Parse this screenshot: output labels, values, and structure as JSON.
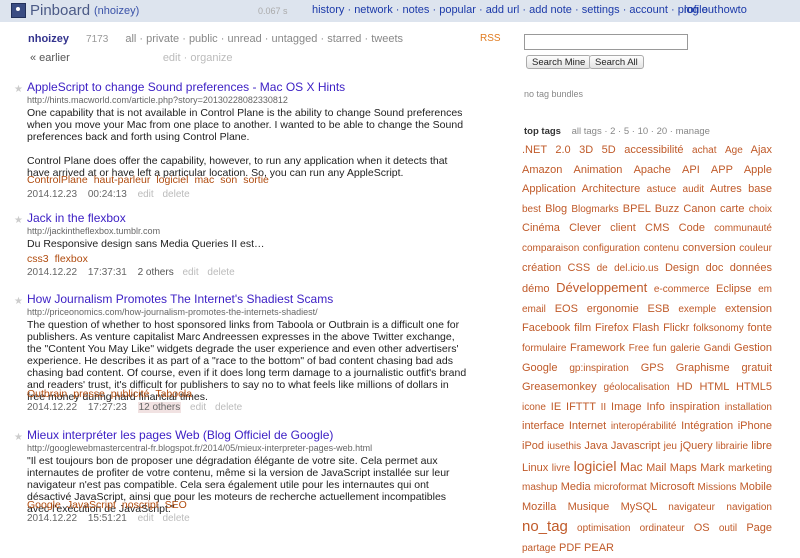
{
  "header": {
    "brand": "Pinboard",
    "user": "(nhoizey)",
    "timing": "0.067 s",
    "nav": [
      "history",
      "network",
      "notes",
      "popular",
      "add url",
      "add note",
      "settings",
      "account",
      "profile",
      "howto"
    ],
    "logout": "log out"
  },
  "filterbar": {
    "username": "nhoizey",
    "count": "7173",
    "filters": [
      "all",
      "private",
      "public",
      "unread",
      "untagged",
      "starred",
      "tweets"
    ],
    "rss": "RSS"
  },
  "pager": {
    "earlier": "« earlier",
    "edit": "edit",
    "organize": "organize"
  },
  "bookmarks": [
    {
      "title": "AppleScript to change Sound preferences - Mac OS X Hints",
      "url": "http://hints.macworld.com/article.php?story=20130228082330812",
      "desc1": "One capability that is not available in Control Plane is the ability to change Sound preferences when you move your Mac from one place to another. I wanted to be able to change the Sound preferences back and forth using Control Plane.",
      "desc2": "Control Plane does offer the capability, however, to run any application when it detects that have arrived at or have left a particular location. So, you can run any AppleScript.",
      "tags": [
        "ControlPlane",
        "haut-parleur",
        "logiciel",
        "mac",
        "son",
        "sortie"
      ],
      "date": "2014.12.23",
      "time": "00:24:13",
      "others": "",
      "edit": "edit",
      "delete": "delete"
    },
    {
      "title": "Jack in the flexbox",
      "url": "http://jackintheflexbox.tumblr.com",
      "desc1": "Du Responsive design sans Media Queries II est…",
      "desc2": "",
      "tags": [
        "css3",
        "flexbox"
      ],
      "date": "2014.12.22",
      "time": "17:37:31",
      "others": "2 others",
      "edit": "edit",
      "delete": "delete"
    },
    {
      "title": "How Journalism Promotes The Internet's Shadiest Scams",
      "url": "http://priceonomics.com/how-journalism-promotes-the-internets-shadiest/",
      "desc1": "The question of whether to host sponsored links from Taboola or Outbrain is a difficult one for publishers. As venture capitalist Marc Andreessen expresses in the above Twitter exchange, the \"Content You May Like\" widgets degrade the user experience and even other advertisers' experience. He describes it as part of a \"race to the bottom\" of bad content chasing bad ads chasing bad content. Of course, even if it does long term damage to a journalistic outfit's brand and readers' trust, it's difficult for publishers to say no to what feels like millions of dollars in free money during hard financial times.",
      "desc2": "",
      "tags": [
        "Outbrain",
        "presse",
        "publicité",
        "Taboola"
      ],
      "date": "2014.12.22",
      "time": "17:27:23",
      "others": "12 others",
      "edit": "edit",
      "delete": "delete"
    },
    {
      "title": "Mieux interpréter les pages Web (Blog Officiel de Google)",
      "url": "http://googlewebmastercentral-fr.blogspot.fr/2014/05/mieux-interpreter-pages-web.html",
      "desc1": "\"Il est toujours bon de proposer une dégradation élégante de votre site. Cela permet aux internautes de profiter de votre contenu, même si la version de JavaScript installée sur leur navigateur n'est pas compatible. Cela sera également utile pour les internautes qui ont désactivé JavaScript, ainsi que pour les moteurs de recherche actuellement incompatibles avec l'exécution de JavaScript.\"",
      "desc2": "",
      "tags": [
        "Google",
        "JavaScript",
        "noscript",
        "SEO"
      ],
      "date": "2014.12.22",
      "time": "15:51:21",
      "others": "",
      "edit": "edit",
      "delete": "delete"
    }
  ],
  "sidebar": {
    "search_mine": "Search Mine",
    "search_all": "Search All",
    "no_bundles": "no tag bundles",
    "top_tags": "top tags",
    "tag_options": "all tags · 2 · 5 · 10 · 20 · manage",
    "tags": [
      {
        "t": ".NET",
        "s": 11
      },
      {
        "t": "2.0",
        "s": 11
      },
      {
        "t": "3D",
        "s": 11
      },
      {
        "t": "5D",
        "s": 11
      },
      {
        "t": "accessibilité",
        "s": 11
      },
      {
        "t": "achat",
        "s": 10
      },
      {
        "t": "Age",
        "s": 10
      },
      {
        "t": "Ajax",
        "s": 11
      },
      {
        "t": "Amazon",
        "s": 11
      },
      {
        "t": "Animation",
        "s": 11
      },
      {
        "t": "Apache",
        "s": 11
      },
      {
        "t": "API",
        "s": 11
      },
      {
        "t": "APP",
        "s": 11
      },
      {
        "t": "Apple",
        "s": 11
      },
      {
        "t": "Application",
        "s": 11
      },
      {
        "t": "Architecture",
        "s": 11
      },
      {
        "t": "astuce",
        "s": 10
      },
      {
        "t": "audit",
        "s": 10
      },
      {
        "t": "Autres",
        "s": 11
      },
      {
        "t": "base",
        "s": 11
      },
      {
        "t": "best",
        "s": 10
      },
      {
        "t": "Blog",
        "s": 11
      },
      {
        "t": "Blogmarks",
        "s": 10
      },
      {
        "t": "BPEL",
        "s": 11
      },
      {
        "t": "Buzz",
        "s": 11
      },
      {
        "t": "Canon",
        "s": 11
      },
      {
        "t": "carte",
        "s": 11
      },
      {
        "t": "choix",
        "s": 10
      },
      {
        "t": "Cinéma",
        "s": 11
      },
      {
        "t": "Clever",
        "s": 11
      },
      {
        "t": "client",
        "s": 11
      },
      {
        "t": "CMS",
        "s": 11
      },
      {
        "t": "Code",
        "s": 11
      },
      {
        "t": "communauté",
        "s": 10
      },
      {
        "t": "comparaison",
        "s": 10
      },
      {
        "t": "configuration",
        "s": 10
      },
      {
        "t": "contenu",
        "s": 10
      },
      {
        "t": "conversion",
        "s": 11
      },
      {
        "t": "couleur",
        "s": 10
      },
      {
        "t": "création",
        "s": 11
      },
      {
        "t": "CSS",
        "s": 11
      },
      {
        "t": "de",
        "s": 10
      },
      {
        "t": "del.icio.us",
        "s": 10
      },
      {
        "t": "Design",
        "s": 11
      },
      {
        "t": "doc",
        "s": 11
      },
      {
        "t": "données",
        "s": 11
      },
      {
        "t": "démo",
        "s": 11
      },
      {
        "t": "Développement",
        "s": 13
      },
      {
        "t": "e-commerce",
        "s": 10
      },
      {
        "t": "Eclipse",
        "s": 11
      },
      {
        "t": "em",
        "s": 10
      },
      {
        "t": "email",
        "s": 10
      },
      {
        "t": "EOS",
        "s": 11
      },
      {
        "t": "ergonomie",
        "s": 11
      },
      {
        "t": "ESB",
        "s": 11
      },
      {
        "t": "exemple",
        "s": 10
      },
      {
        "t": "extension",
        "s": 11
      },
      {
        "t": "Facebook",
        "s": 11
      },
      {
        "t": "film",
        "s": 11
      },
      {
        "t": "Firefox",
        "s": 11
      },
      {
        "t": "Flash",
        "s": 11
      },
      {
        "t": "Flickr",
        "s": 11
      },
      {
        "t": "folksonomy",
        "s": 10
      },
      {
        "t": "fonte",
        "s": 11
      },
      {
        "t": "formulaire",
        "s": 10
      },
      {
        "t": "Framework",
        "s": 11
      },
      {
        "t": "Free",
        "s": 10
      },
      {
        "t": "fun",
        "s": 10
      },
      {
        "t": "galerie",
        "s": 10
      },
      {
        "t": "Gandi",
        "s": 10
      },
      {
        "t": "Gestion",
        "s": 11
      },
      {
        "t": "Google",
        "s": 11
      },
      {
        "t": "gp:inspiration",
        "s": 10
      },
      {
        "t": "GPS",
        "s": 11
      },
      {
        "t": "Graphisme",
        "s": 11
      },
      {
        "t": "gratuit",
        "s": 11
      },
      {
        "t": "Greasemonkey",
        "s": 11
      },
      {
        "t": "géolocalisation",
        "s": 10
      },
      {
        "t": "HD",
        "s": 11
      },
      {
        "t": "HTML",
        "s": 11
      },
      {
        "t": "HTML5",
        "s": 11
      },
      {
        "t": "icone",
        "s": 10
      },
      {
        "t": "IE",
        "s": 11
      },
      {
        "t": "IFTTT",
        "s": 11
      },
      {
        "t": "II",
        "s": 10
      },
      {
        "t": "Image",
        "s": 11
      },
      {
        "t": "Info",
        "s": 11
      },
      {
        "t": "inspiration",
        "s": 11
      },
      {
        "t": "installation",
        "s": 10
      },
      {
        "t": "interface",
        "s": 11
      },
      {
        "t": "Internet",
        "s": 11
      },
      {
        "t": "interopérabilité",
        "s": 10
      },
      {
        "t": "Intégration",
        "s": 11
      },
      {
        "t": "iPhone",
        "s": 11
      },
      {
        "t": "iPod",
        "s": 11
      },
      {
        "t": "iusethis",
        "s": 10
      },
      {
        "t": "Java",
        "s": 11
      },
      {
        "t": "Javascript",
        "s": 11
      },
      {
        "t": "jeu",
        "s": 10
      },
      {
        "t": "jQuery",
        "s": 11
      },
      {
        "t": "librairie",
        "s": 10
      },
      {
        "t": "libre",
        "s": 11
      },
      {
        "t": "Linux",
        "s": 11
      },
      {
        "t": "livre",
        "s": 10
      },
      {
        "t": "logiciel",
        "s": 14
      },
      {
        "t": "Mac",
        "s": 12
      },
      {
        "t": "Mail",
        "s": 11
      },
      {
        "t": "Maps",
        "s": 11
      },
      {
        "t": "Mark",
        "s": 11
      },
      {
        "t": "marketing",
        "s": 10
      },
      {
        "t": "mashup",
        "s": 10
      },
      {
        "t": "Media",
        "s": 11
      },
      {
        "t": "microformat",
        "s": 10
      },
      {
        "t": "Microsoft",
        "s": 11
      },
      {
        "t": "Missions",
        "s": 10
      },
      {
        "t": "Mobile",
        "s": 11
      },
      {
        "t": "Mozilla",
        "s": 11
      },
      {
        "t": "Musique",
        "s": 11
      },
      {
        "t": "MySQL",
        "s": 11
      },
      {
        "t": "navigateur",
        "s": 10
      },
      {
        "t": "navigation",
        "s": 10
      },
      {
        "t": "no_tag",
        "s": 15
      },
      {
        "t": "optimisation",
        "s": 10
      },
      {
        "t": "ordinateur",
        "s": 10
      },
      {
        "t": "OS",
        "s": 11
      },
      {
        "t": "outil",
        "s": 10
      },
      {
        "t": "Page",
        "s": 11
      },
      {
        "t": "partage",
        "s": 10
      },
      {
        "t": "PDF",
        "s": 11
      },
      {
        "t": "PEAR",
        "s": 11
      }
    ]
  },
  "colors": {
    "topbar": "#dde4ee",
    "link": "#1c3aa9",
    "title": "#3b1ec4",
    "tag": "#b04b0e",
    "cloud": "#c05a29"
  }
}
